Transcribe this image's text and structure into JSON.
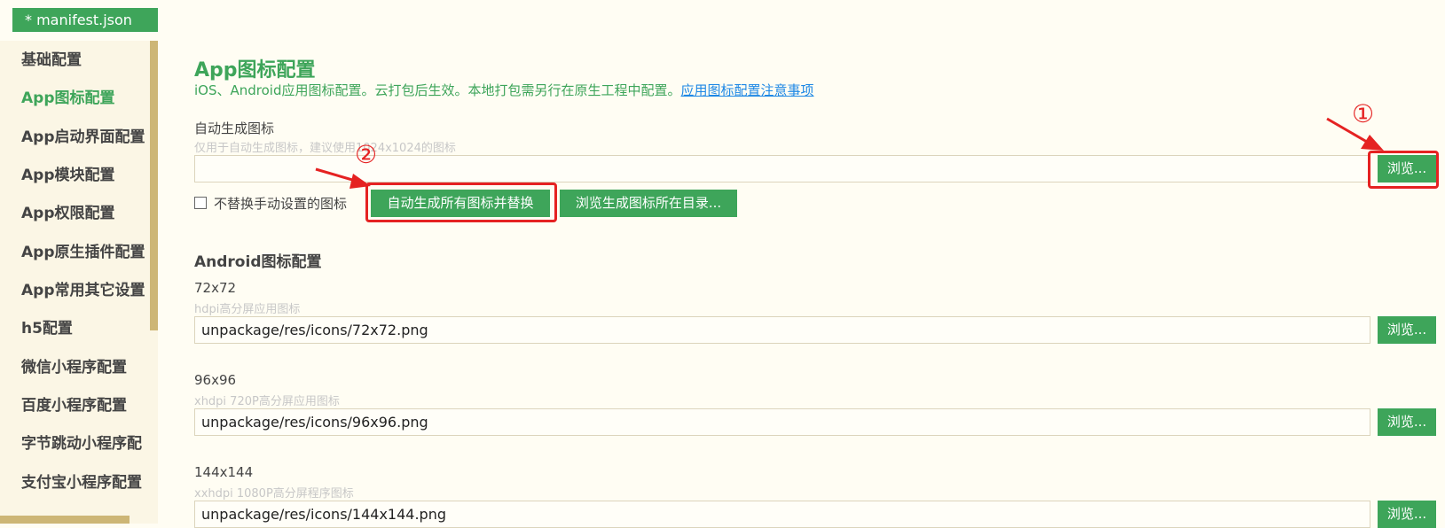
{
  "tab": {
    "title": "* manifest.json"
  },
  "sidebar": {
    "items": [
      {
        "label": "基础配置"
      },
      {
        "label": "App图标配置"
      },
      {
        "label": "App启动界面配置"
      },
      {
        "label": "App模块配置"
      },
      {
        "label": "App权限配置"
      },
      {
        "label": "App原生插件配置"
      },
      {
        "label": "App常用其它设置"
      },
      {
        "label": "h5配置"
      },
      {
        "label": "微信小程序配置"
      },
      {
        "label": "百度小程序配置"
      },
      {
        "label": "字节跳动小程序配"
      },
      {
        "label": "支付宝小程序配置"
      }
    ],
    "active_index": 1
  },
  "main": {
    "title": "App图标配置",
    "description": "iOS、Android应用图标配置。云打包后生效。本地打包需另行在原生工程中配置。",
    "notes_link": "应用图标配置注意事项",
    "auto_gen": {
      "label": "自动生成图标",
      "hint": "仅用于自动生成图标，建议使用1024x1024的图标",
      "value": "",
      "browse_label": "浏览...",
      "checkbox_label": "不替换手动设置的图标",
      "checkbox_checked": false,
      "generate_label": "自动生成所有图标并替换",
      "browse_dir_label": "浏览生成图标所在目录..."
    },
    "android": {
      "title": "Android图标配置",
      "fields": [
        {
          "label": "72x72",
          "hint": "hdpi高分屏应用图标",
          "value": "unpackage/res/icons/72x72.png",
          "browse_label": "浏览..."
        },
        {
          "label": "96x96",
          "hint": "xhdpi 720P高分屏应用图标",
          "value": "unpackage/res/icons/96x96.png",
          "browse_label": "浏览..."
        },
        {
          "label": "144x144",
          "hint": "xxhdpi 1080P高分屏程序图标",
          "value": "unpackage/res/icons/144x144.png",
          "browse_label": "浏览..."
        }
      ]
    }
  },
  "annotations": {
    "step1": "①",
    "step2": "②",
    "color": "#E52222"
  },
  "colors": {
    "accent": "#3EA55A",
    "link": "#1E88E5",
    "background": "#FFFDF3",
    "sidebar_scrollbar": "#CDB676"
  }
}
